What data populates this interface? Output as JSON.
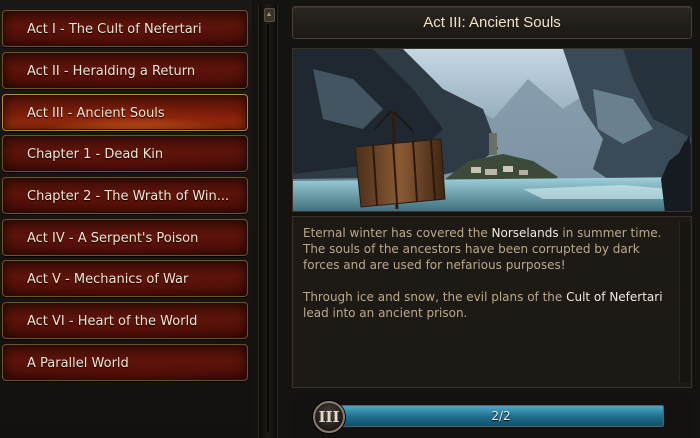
{
  "menu": {
    "items": [
      {
        "label": "Act I - The Cult of Nefertari"
      },
      {
        "label": "Act II - Heralding a Return"
      },
      {
        "label": "Act III - Ancient Souls"
      },
      {
        "label": "Chapter 1 - Dead Kin"
      },
      {
        "label": "Chapter 2 - The Wrath of Win..."
      },
      {
        "label": "Act IV - A Serpent's Poison"
      },
      {
        "label": "Act V - Mechanics of War"
      },
      {
        "label": "Act VI - Heart of the World"
      },
      {
        "label": "A Parallel World"
      }
    ],
    "selected_index": 2
  },
  "panel": {
    "title": "Act III: Ancient Souls",
    "art_icon": "frozen-fjord-viking-ship-illustration",
    "description": {
      "p1_a": "Eternal winter has covered the ",
      "p1_hl": "Norselands",
      "p1_b": " in summer time. The souls of the ancestors have been corrupted by dark forces and are used for nefarious purposes!",
      "p2_a": "Through ice and snow, the evil plans of the ",
      "p2_hl": "Cult of Nefertari",
      "p2_b": " lead into an ancient prison."
    },
    "progress": {
      "numeral": "III",
      "text": "2/2",
      "fraction": 1.0
    }
  },
  "colors": {
    "menu_red": "#5b140a",
    "menu_selected_glow": "#ff7828",
    "gold_border": "#b58a3c",
    "text_highlight": "#f0e8dc",
    "text_body": "#bca988",
    "progress_blue": "#1f6e8c"
  }
}
